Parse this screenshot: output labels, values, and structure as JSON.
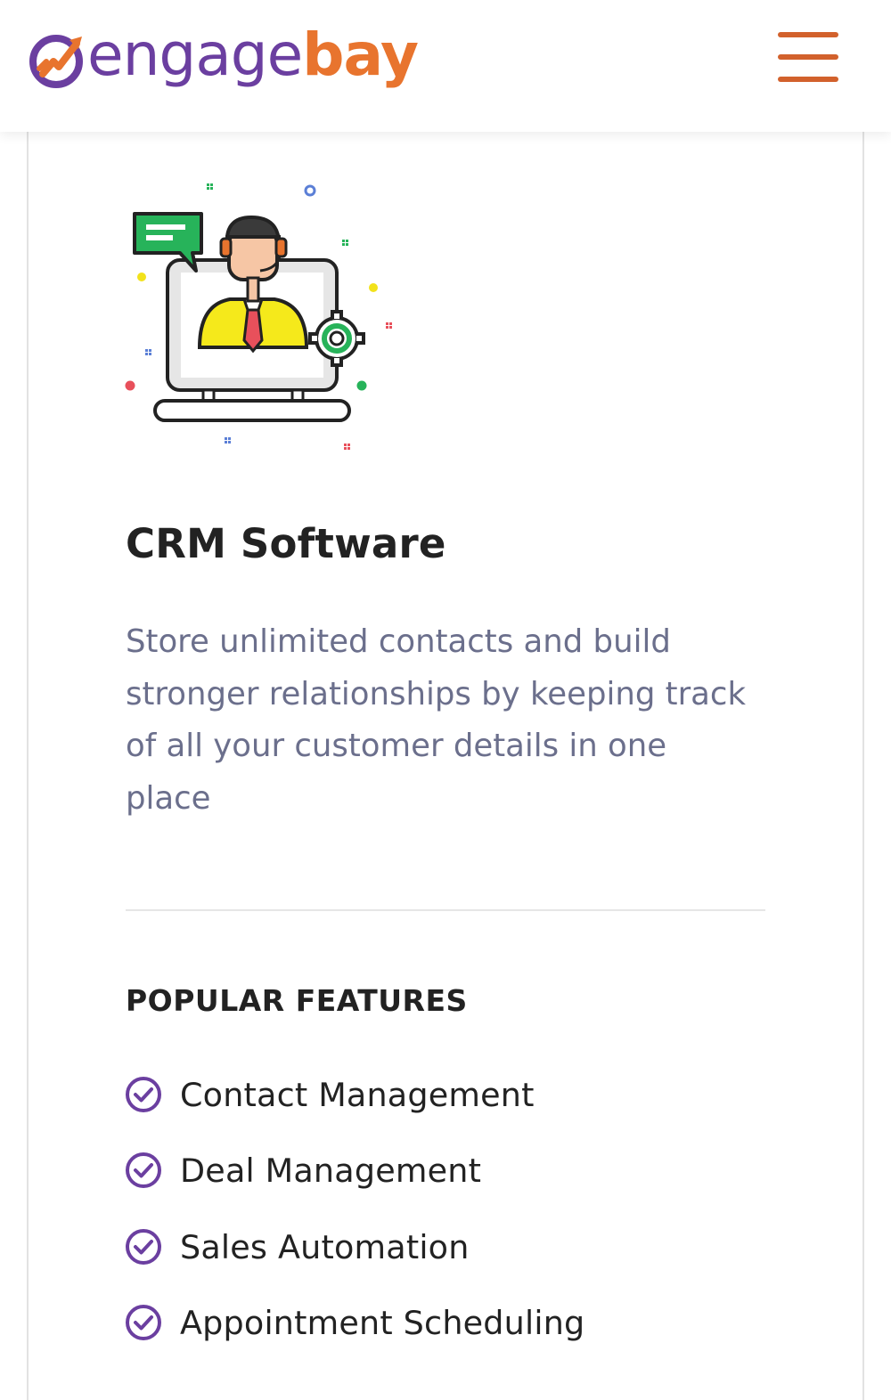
{
  "header": {
    "logo": {
      "part1": "engage",
      "part2": "bay",
      "brand_purple": "#6b3fa0",
      "brand_orange": "#e8742e"
    },
    "menu_icon": "hamburger-menu-icon",
    "menu_color": "#d2612c"
  },
  "card": {
    "illustration": "crm-support-agent-laptop-illustration",
    "title": "CRM Software",
    "description": "Store unlimited contacts and build stronger relationships by keeping track of all your customer details in one place",
    "features_heading": "POPULAR FEATURES",
    "check_icon": "check-circle-icon",
    "check_color": "#6b3fa0",
    "features": [
      {
        "label": "Contact Management"
      },
      {
        "label": "Deal Management"
      },
      {
        "label": "Sales Automation"
      },
      {
        "label": "Appointment Scheduling"
      }
    ]
  }
}
